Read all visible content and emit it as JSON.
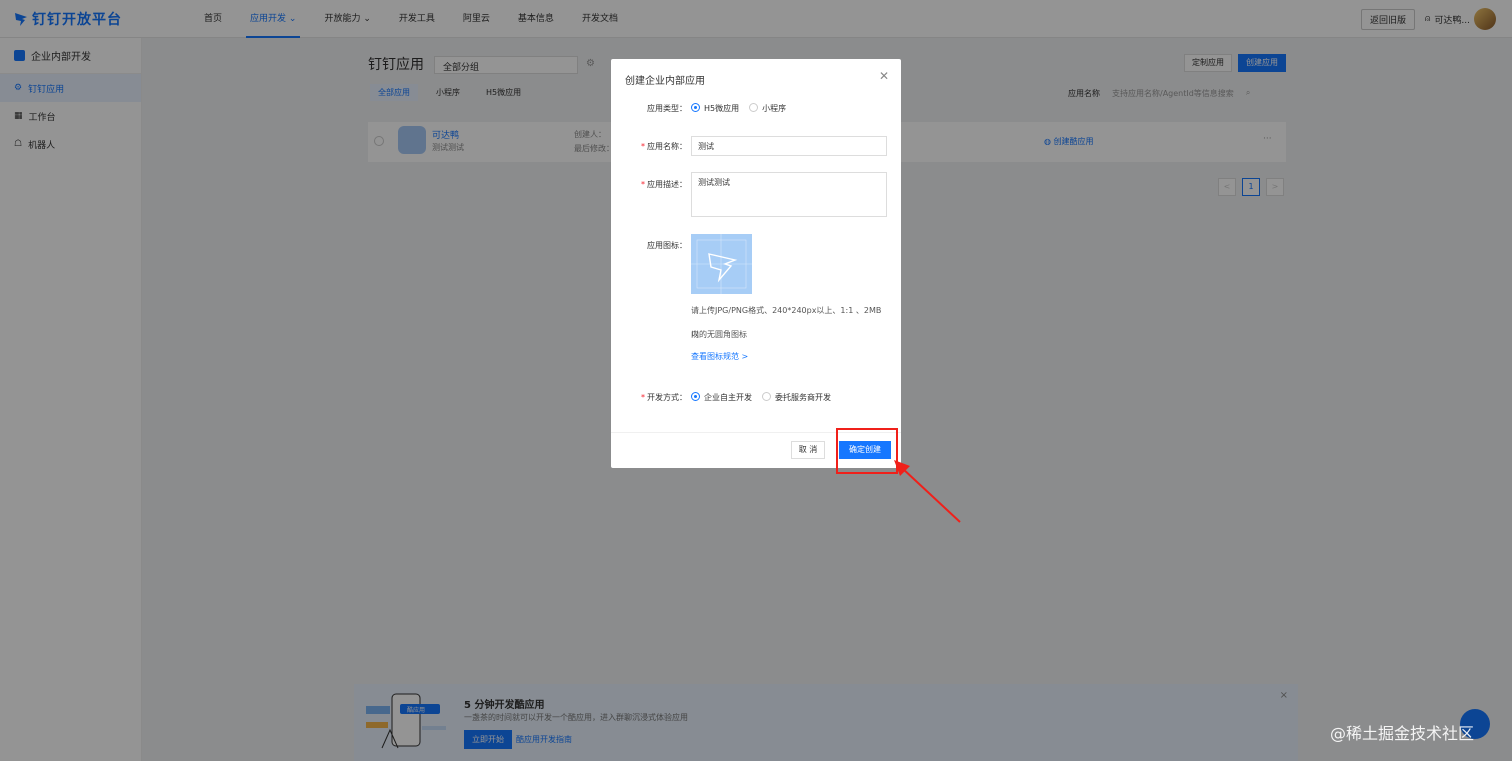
{
  "brand": {
    "name": "钉钉开放平台"
  },
  "nav": {
    "items": [
      "首页",
      "应用开发",
      "开放能力",
      "开发工具",
      "阿里云",
      "基本信息",
      "开发文档"
    ],
    "active_index": 1
  },
  "top_right": {
    "old_button": "返回旧版",
    "user_name": "可达鸭..."
  },
  "sidebar": {
    "header": "企业内部开发",
    "items": [
      "钉钉应用",
      "工作台",
      "机器人"
    ],
    "active_index": 0
  },
  "page": {
    "title": "钉钉应用",
    "group_select": "全部分组",
    "custom_button": "定制应用",
    "create_button": "创建应用",
    "tabs": [
      "全部应用",
      "小程序",
      "H5微应用"
    ],
    "active_tab": 0,
    "search_label": "应用名称",
    "search_placeholder": "支持应用名称/AgentId等信息搜索"
  },
  "app": {
    "name": "可达鸭",
    "desc": "测试测试",
    "creator_label": "创建人：",
    "modified_label": "最后修改：",
    "action": "创建酷应用",
    "more": "···"
  },
  "pagination": {
    "prev": "<",
    "current": "1",
    "next": ">"
  },
  "modal": {
    "title": "创建企业内部应用",
    "type_label": "应用类型：",
    "type_options": [
      "H5微应用",
      "小程序"
    ],
    "type_selected": 0,
    "name_label": "应用名称：",
    "name_value": "测试",
    "desc_label": "应用描述：",
    "desc_value": "测试测试",
    "icon_label": "应用图标：",
    "icon_hint_1": "请上传JPG/PNG格式、240*240px以上、1:1 、2MB 以",
    "icon_hint_2": "内的无圆角图标",
    "icon_link": "查看图标规范 >",
    "dev_label": "开发方式：",
    "dev_options": [
      "企业自主开发",
      "委托服务商开发"
    ],
    "dev_selected": 0,
    "cancel": "取 消",
    "confirm": "确定创建"
  },
  "promo": {
    "title": "5 分钟开发酷应用",
    "desc": "一盏茶的时间就可以开发一个酷应用，进入群聊沉浸式体验应用",
    "art_label": "酷应用",
    "start_button": "立即开始",
    "guide_link": "酷应用开发指南",
    "close": "×"
  },
  "watermark": "@稀土掘金技术社区",
  "colors": {
    "primary": "#1677ff",
    "highlight": "#f0201a"
  }
}
